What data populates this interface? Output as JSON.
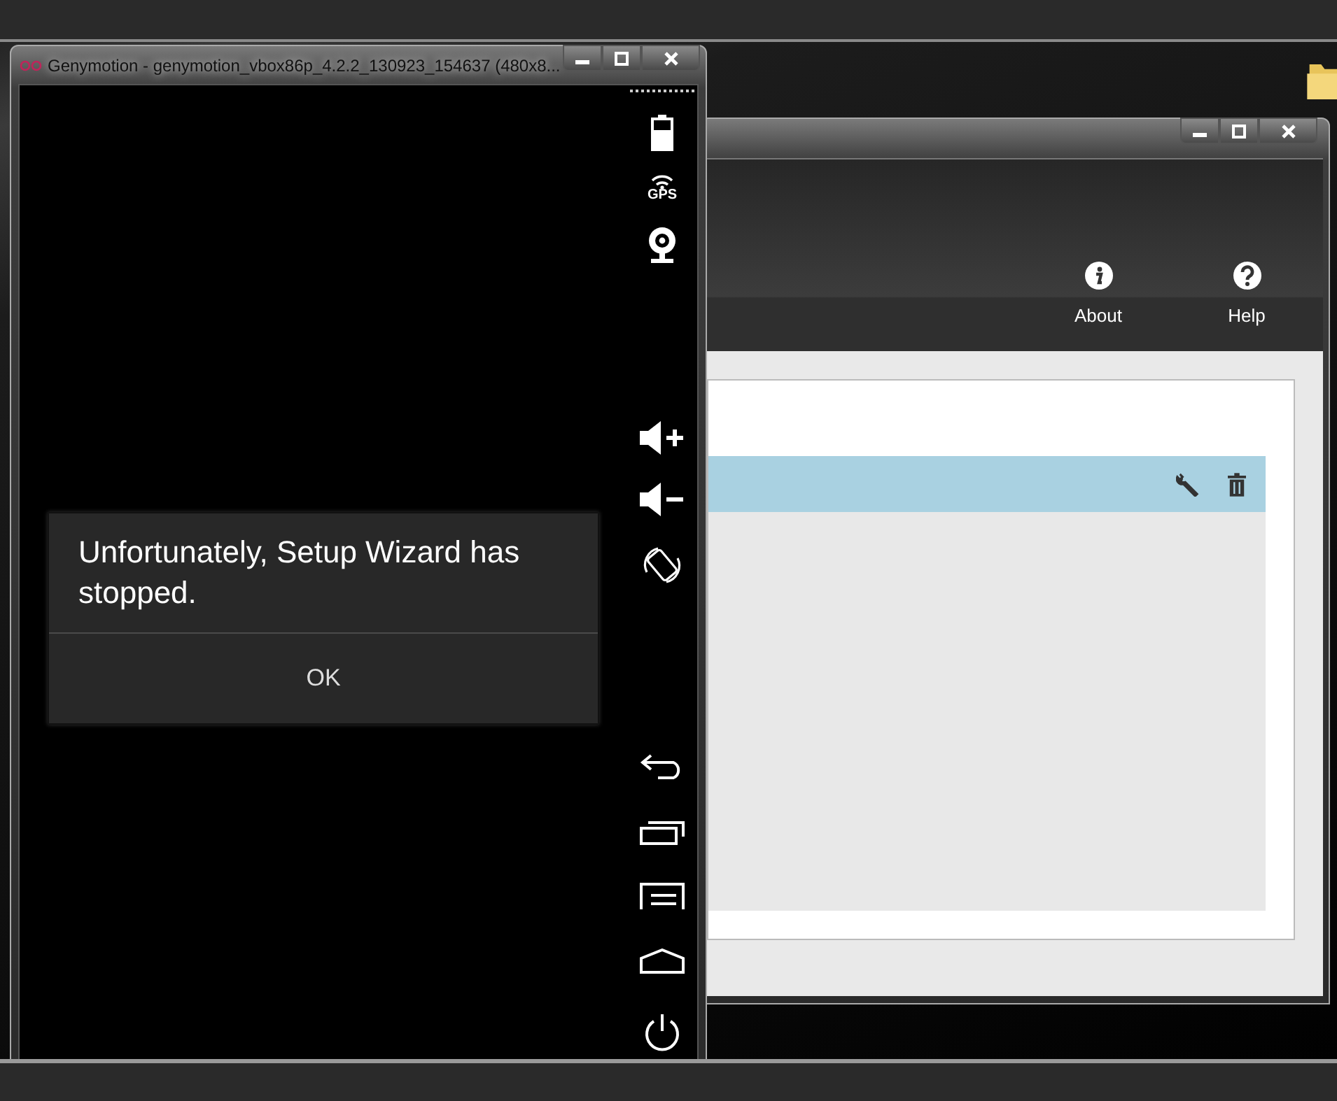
{
  "emulator_window": {
    "title": "Genymotion - genymotion_vbox86p_4.2.2_130923_154637 (480x8...",
    "tool_groups": [
      [
        {
          "kind": "battery"
        },
        {
          "kind": "gps",
          "label": "GPS"
        },
        {
          "kind": "webcam"
        }
      ],
      [
        {
          "kind": "volume-up"
        },
        {
          "kind": "volume-down"
        },
        {
          "kind": "rotate"
        }
      ],
      [
        {
          "kind": "back"
        },
        {
          "kind": "recent"
        },
        {
          "kind": "menu"
        },
        {
          "kind": "home"
        },
        {
          "kind": "power"
        }
      ]
    ]
  },
  "dialog": {
    "message": "Unfortunately, Setup Wizard has stopped.",
    "button": "OK"
  },
  "launcher_window": {
    "toolbar": [
      {
        "kind": "info",
        "label": "About"
      },
      {
        "kind": "help",
        "label": "Help"
      }
    ],
    "devices": [
      {
        "selected": true
      }
    ]
  }
}
